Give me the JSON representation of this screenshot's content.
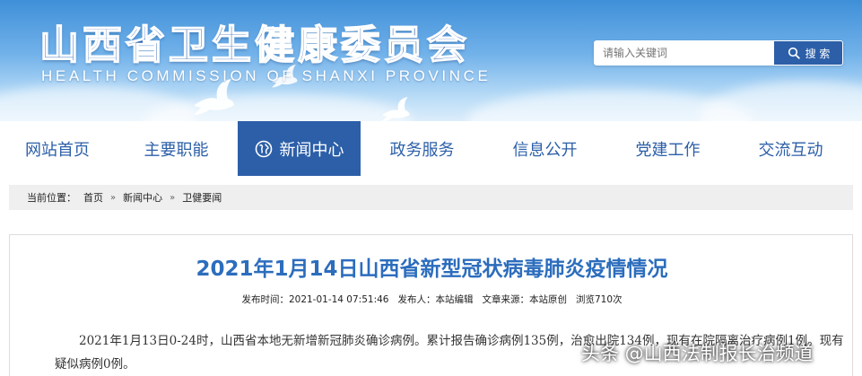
{
  "header": {
    "title": "山西省卫生健康委员会",
    "subtitle": "HEALTH COMMISSION OF SHANXI PROVINCE"
  },
  "search": {
    "placeholder": "请输入关键词",
    "button_label": "搜 索"
  },
  "nav": {
    "items": [
      {
        "label": "网站首页"
      },
      {
        "label": "主要职能"
      },
      {
        "label": "新闻中心",
        "active": true
      },
      {
        "label": "政务服务"
      },
      {
        "label": "信息公开"
      },
      {
        "label": "党建工作"
      },
      {
        "label": "交流互动"
      }
    ]
  },
  "breadcrumb": {
    "prefix": "当前位置：",
    "items": [
      "首页",
      "新闻中心",
      "卫健要闻"
    ],
    "separator": "»"
  },
  "article": {
    "title": "2021年1月14日山西省新型冠状病毒肺炎疫情情况",
    "meta": {
      "publish_time_label": "发布时间：",
      "publish_time": "2021-01-14 07:51:46",
      "publisher_label": "发布人：",
      "publisher": "本站编辑",
      "source_label": "文章来源：",
      "source": "本站原创",
      "views": "浏览710次"
    },
    "body": "2021年1月13日0-24时，山西省本地无新增新冠肺炎确诊病例。累计报告确诊病例135例，治愈出院134例，现有在院隔离治疗病例1例。现有疑似病例0例。"
  },
  "watermark": "头条 @山西法制报长治频道",
  "colors": {
    "primary": "#2c5fa8",
    "title_blue": "#2c6dbd",
    "breadcrumb_bg": "#efefef"
  },
  "icons": {
    "search": "search-icon",
    "nav_active": "globe-icon",
    "brand": "dove-icon"
  }
}
